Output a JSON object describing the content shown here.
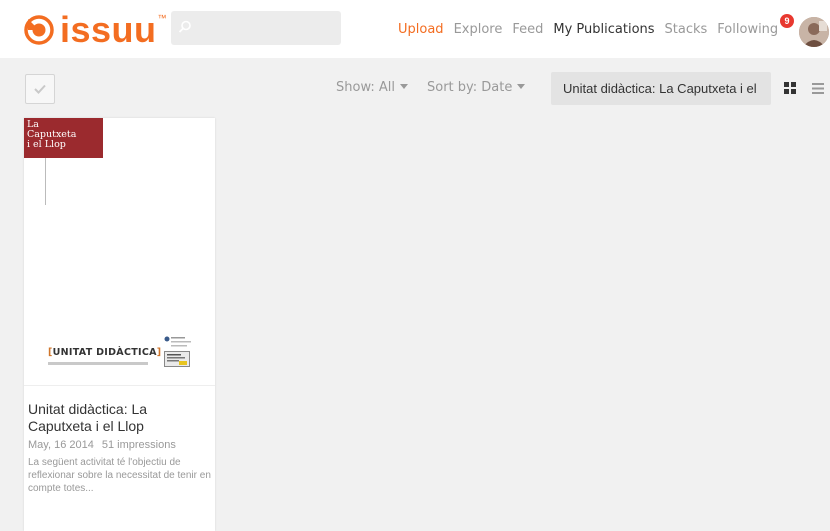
{
  "brand": {
    "logo_text": "issuu",
    "accent": "#f36d21"
  },
  "search": {
    "placeholder": ""
  },
  "nav": {
    "upload": "Upload",
    "explore": "Explore",
    "feed": "Feed",
    "my_publications": "My Publications",
    "stacks": "Stacks",
    "following": "Following",
    "following_badge": "9"
  },
  "toolbar": {
    "show_label": "Show: All",
    "sort_label": "Sort by: Date",
    "publication_select": "Unitat didàctica: La Caputxeta i el"
  },
  "publications": [
    {
      "cover_title_lines": [
        "La",
        "Caputxeta",
        "i el Llop"
      ],
      "cover_heading_open": "[",
      "cover_heading": "UNITAT DIDÀCTICA",
      "cover_heading_close": "]",
      "title": "Unitat didàctica: La Caputxeta i el Llop",
      "date": "May, 16 2014",
      "impressions": "51 impressions",
      "description": "La següent activitat té l'objectiu de reflexionar sobre la necessitat de tenir en compte totes..."
    }
  ]
}
